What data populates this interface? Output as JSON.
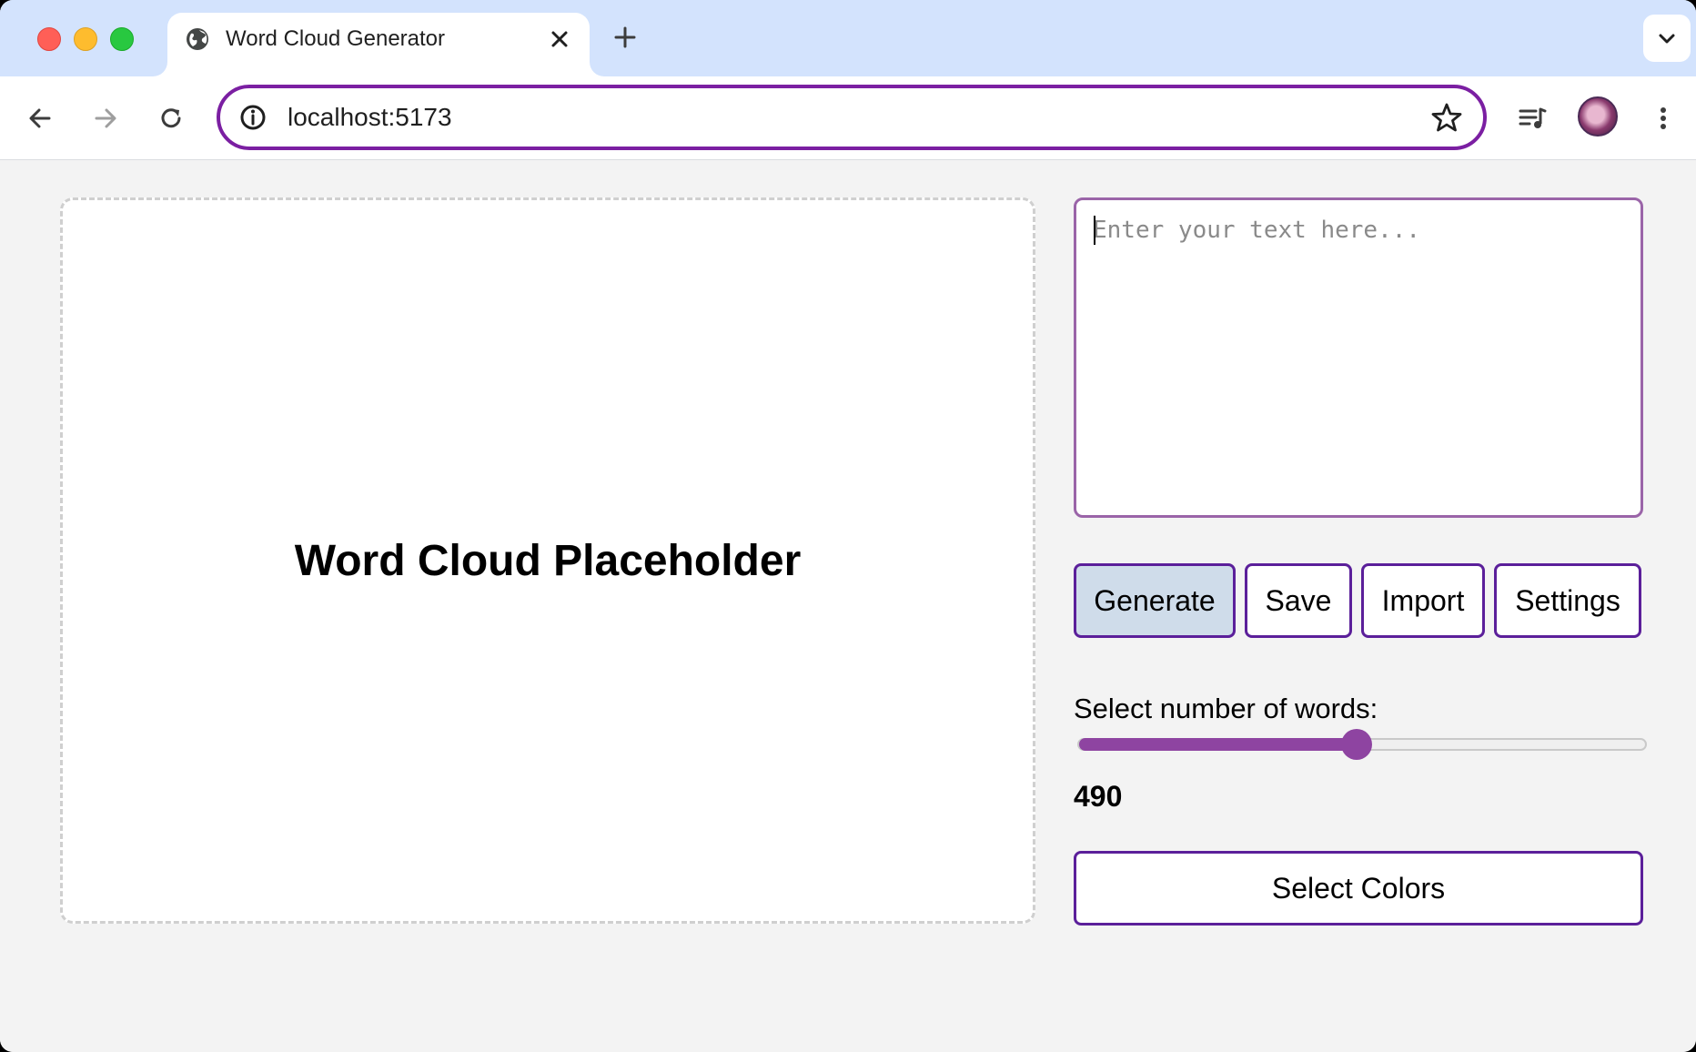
{
  "browser": {
    "tab_title": "Word Cloud Generator",
    "url": "localhost:5173"
  },
  "canvas": {
    "placeholder": "Word Cloud Placeholder"
  },
  "input": {
    "placeholder": "Enter your text here...",
    "value": ""
  },
  "actions": {
    "generate": "Generate",
    "save": "Save",
    "import": "Import",
    "settings": "Settings",
    "select_colors": "Select Colors"
  },
  "word_count": {
    "label": "Select number of words:",
    "value": "490",
    "fraction": 0.49
  },
  "colors": {
    "accent": "#5b1f9a",
    "slider": "#8e44a1",
    "omnibox_border": "#7b1fa2",
    "generate_bg": "#cfdcea"
  }
}
